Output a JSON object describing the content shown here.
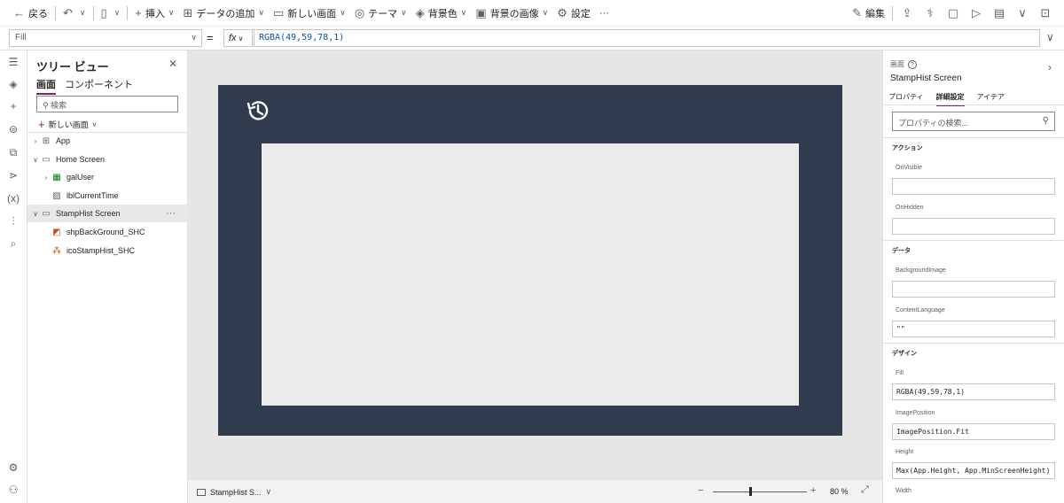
{
  "toolbar": {
    "back": "戻る",
    "insert": "挿入",
    "add_data": "データの追加",
    "new_screen": "新しい画面",
    "theme": "テーマ",
    "bg_color": "背景色",
    "bg_image": "背景の画像",
    "settings": "設定",
    "more": "···",
    "edit": "編集"
  },
  "formula": {
    "property": "Fill",
    "fx": "fx",
    "value": "RGBA(49,59,78,1)"
  },
  "tree": {
    "title": "ツリー ビュー",
    "tabs": [
      "画面",
      "コンポーネント"
    ],
    "search_placeholder": "検索",
    "new_screen": "新しい画面",
    "nodes": [
      {
        "label": "App"
      },
      {
        "label": "Home Screen"
      },
      {
        "label": "galUser"
      },
      {
        "label": "lblCurrentTime"
      },
      {
        "label": "StampHist Screen"
      },
      {
        "label": "shpBackGround_SHC"
      },
      {
        "label": "icoStampHist_SHC"
      }
    ],
    "more": "···"
  },
  "canvas": {
    "screen_color": "#313b4e",
    "shape_color": "#ebebeb"
  },
  "status": {
    "screen_name": "StampHist S...",
    "zoom": "80",
    "zoom_unit": "%"
  },
  "props": {
    "kind": "画面",
    "name": "StampHist Screen",
    "tabs": [
      "プロパティ",
      "詳細設定",
      "アイテア"
    ],
    "search_placeholder": "プロパティの検索...",
    "sections": {
      "action": "アクション",
      "data": "データ",
      "design": "デザイン"
    },
    "fields": {
      "onvisible_label": "OnVisible",
      "onvisible_value": "",
      "onhidden_label": "OnHidden",
      "onhidden_value": "",
      "bgimage_label": "BackgroundImage",
      "bgimage_value": "",
      "contentlang_label": "ContentLanguage",
      "contentlang_value": "\"\"",
      "fill_label": "Fill",
      "fill_value": "RGBA(49,59,78,1)",
      "imagepos_label": "ImagePosition",
      "imagepos_value": "ImagePosition.Fit",
      "height_label": "Height",
      "height_value": "Max(App.Height, App.MinScreenHeight)",
      "width_label": "Width"
    }
  }
}
